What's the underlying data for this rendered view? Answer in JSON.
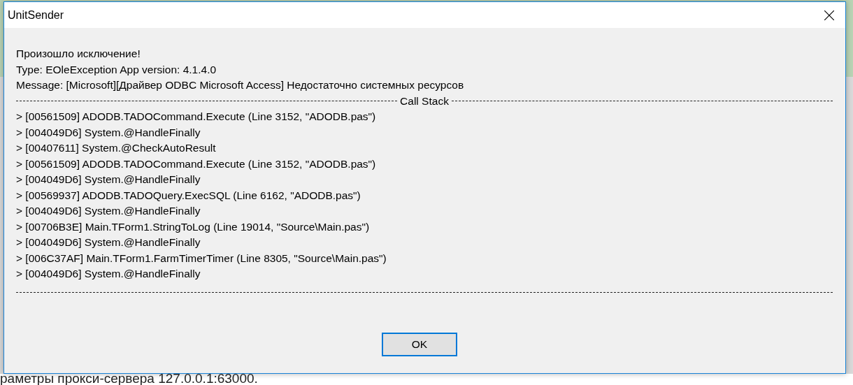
{
  "window": {
    "title": "UnitSender"
  },
  "message_lines": [
    "Произошло исключение!",
    "Type: EOleException App version: 4.1.4.0",
    "Message: [Microsoft][Драйвер ODBC Microsoft Access] Недостаточно системных ресурсов"
  ],
  "call_stack": {
    "title": "Call Stack",
    "entries": [
      "> [00561509] ADODB.TADOCommand.Execute (Line 3152, \"ADODB.pas\")",
      "> [004049D6] System.@HandleFinally",
      "> [00407611] System.@CheckAutoResult",
      "> [00561509] ADODB.TADOCommand.Execute (Line 3152, \"ADODB.pas\")",
      "> [004049D6] System.@HandleFinally",
      "> [00569937] ADODB.TADOQuery.ExecSQL (Line 6162, \"ADODB.pas\")",
      "> [004049D6] System.@HandleFinally",
      "> [00706B3E] Main.TForm1.StringToLog (Line 19014, \"Source\\Main.pas\")",
      "> [004049D6] System.@HandleFinally",
      "> [006C37AF] Main.TForm1.FarmTimerTimer (Line 8305, \"Source\\Main.pas\")",
      "> [004049D6] System.@HandleFinally"
    ]
  },
  "buttons": [
    {
      "label": "OK",
      "default": true
    }
  ],
  "background_text": "раметры прокси-сервера 127.0.0.1:63000."
}
